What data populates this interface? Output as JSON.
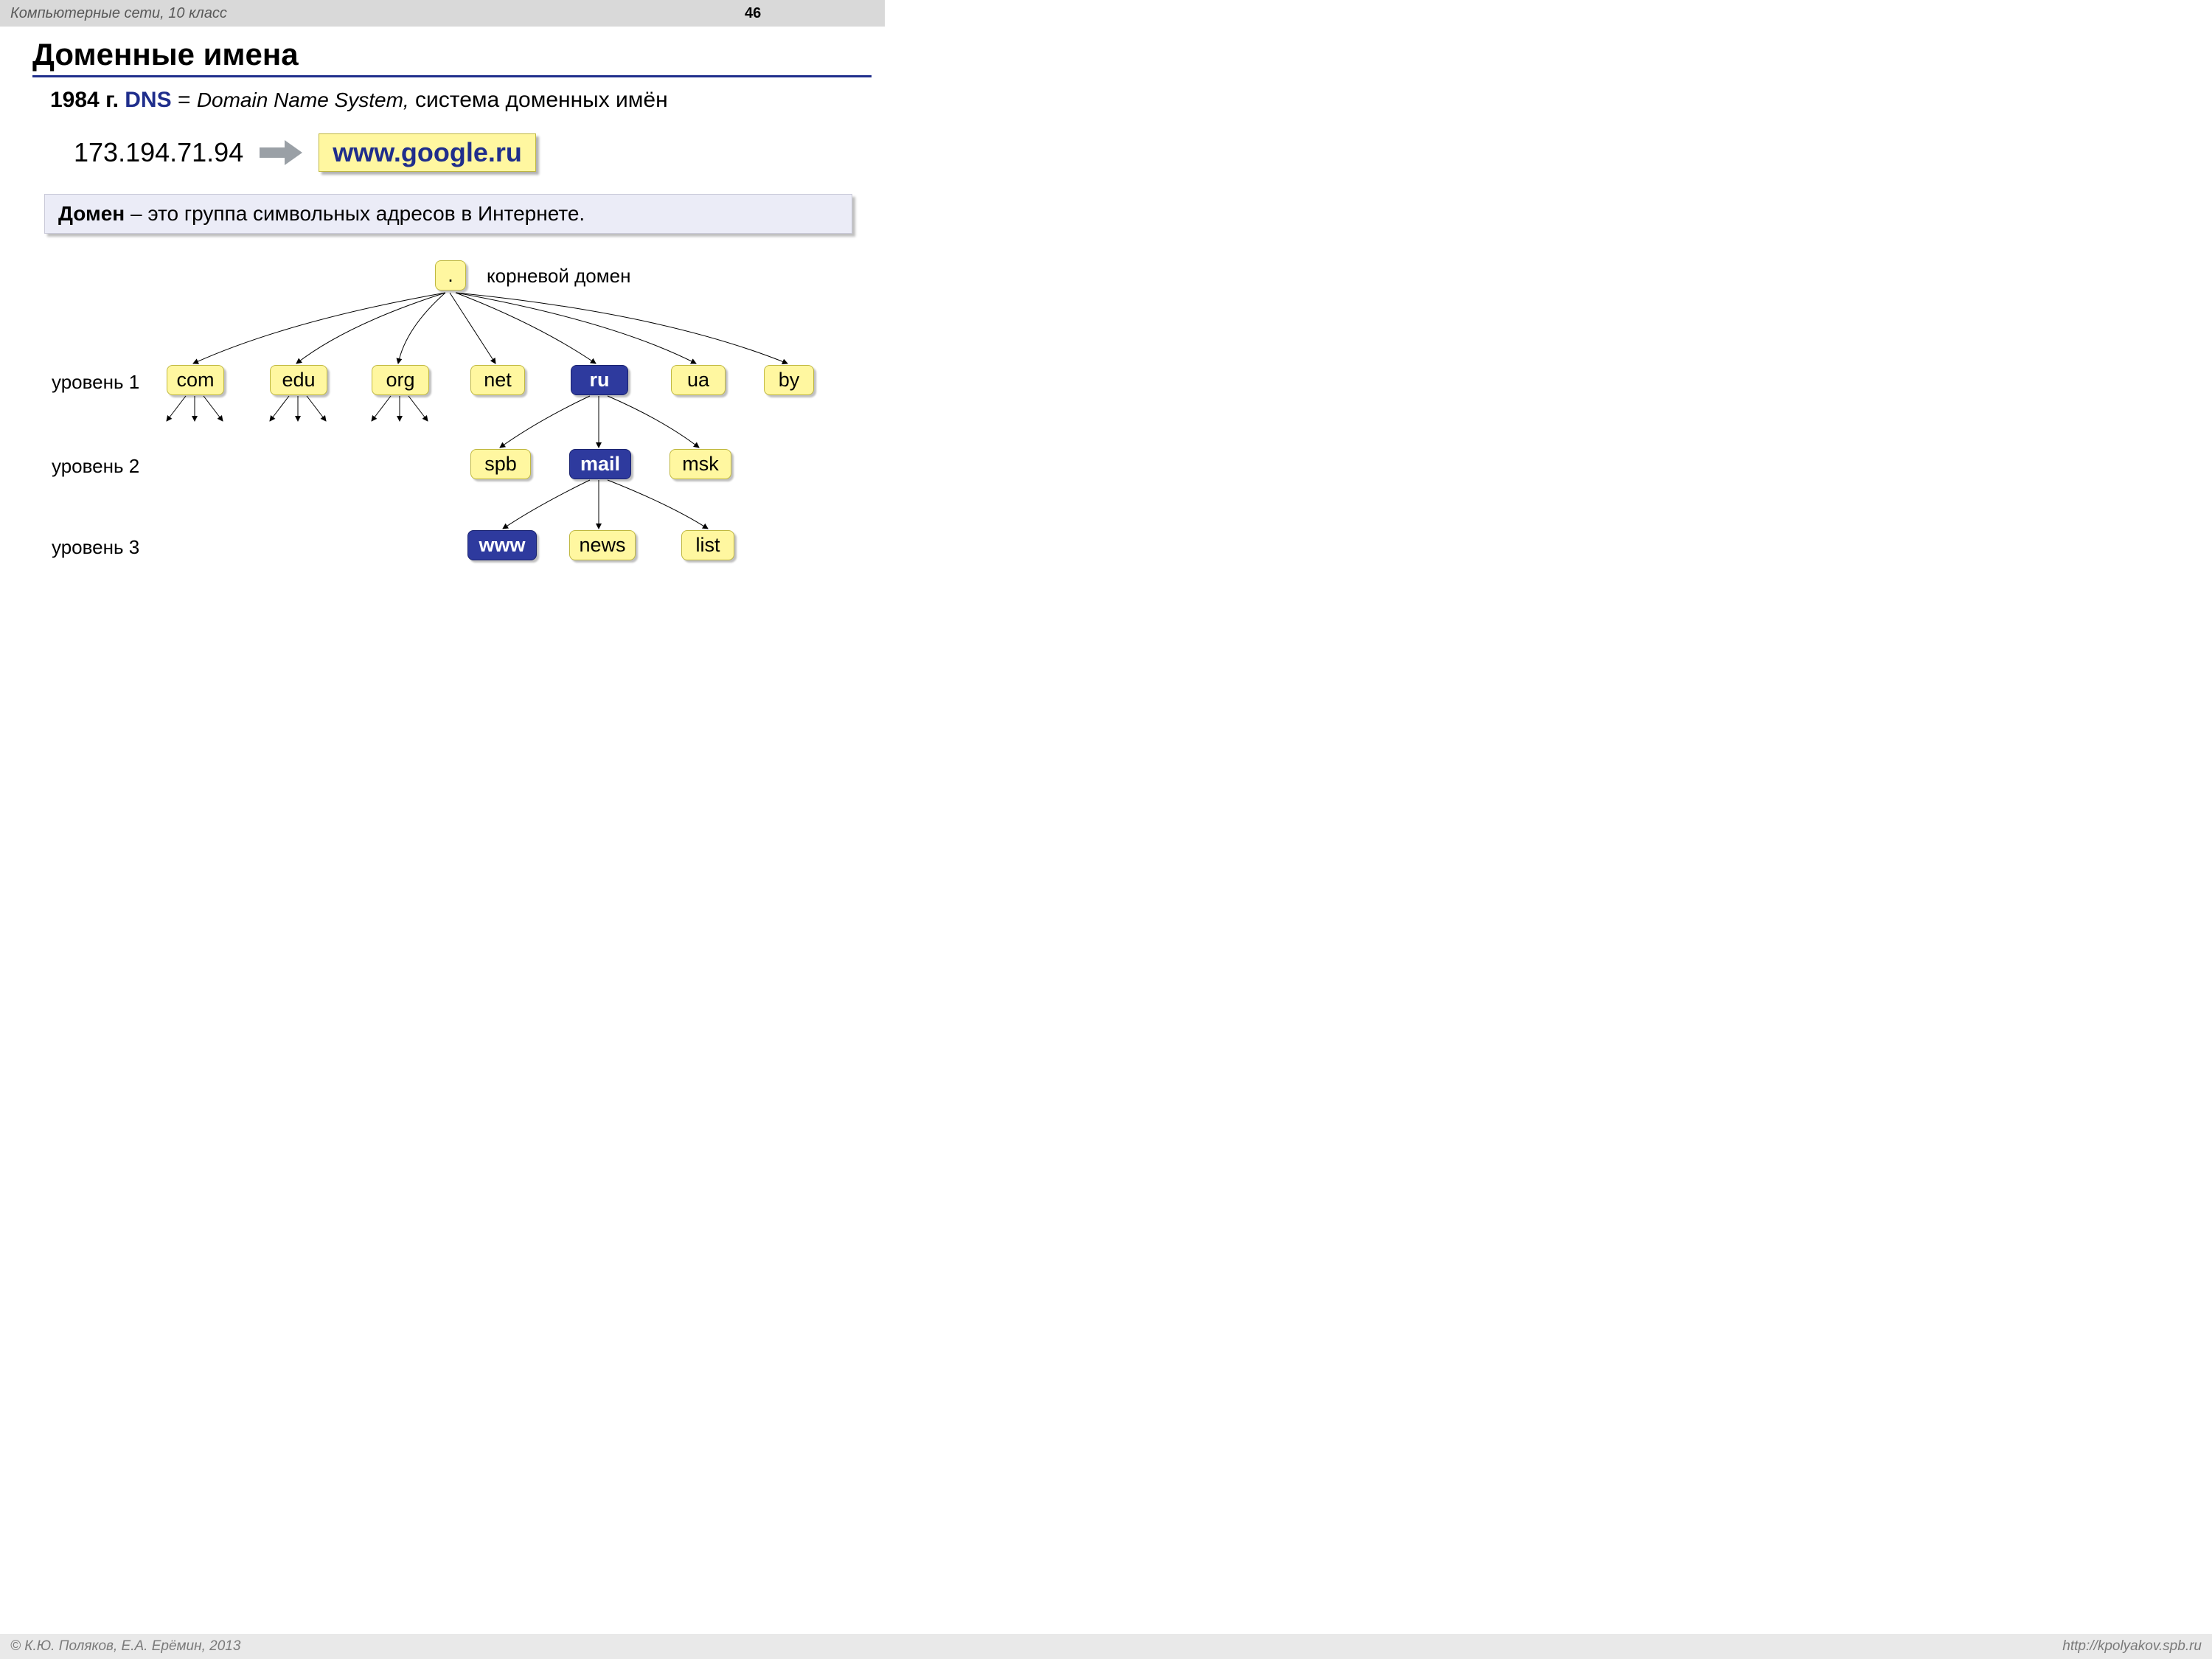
{
  "header": {
    "course": "Компьютерные сети, 10 класс",
    "page": "46"
  },
  "title": "Доменные имена",
  "dns_line": {
    "year": "1984 г.",
    "dns": "DNS",
    "eq": "=",
    "eng": "Domain Name System,",
    "ru": "система доменных имён"
  },
  "ip": "173.194.71.94",
  "google": "www.google.ru",
  "definition": {
    "term": "Домен",
    "rest": " – это группа символьных адресов в Интернете."
  },
  "tree": {
    "root_label": "корневой домен",
    "root": ".",
    "level_labels": [
      "уровень 1",
      "уровень 2",
      "уровень 3"
    ],
    "l1": [
      "com",
      "edu",
      "org",
      "net",
      "ru",
      "ua",
      "by"
    ],
    "l2": [
      "spb",
      "mail",
      "msk"
    ],
    "l3": [
      "www",
      "news",
      "list"
    ]
  },
  "footer": {
    "left": "© К.Ю. Поляков, Е.А. Ерёмин, 2013",
    "right": "http://kpolyakov.spb.ru"
  }
}
